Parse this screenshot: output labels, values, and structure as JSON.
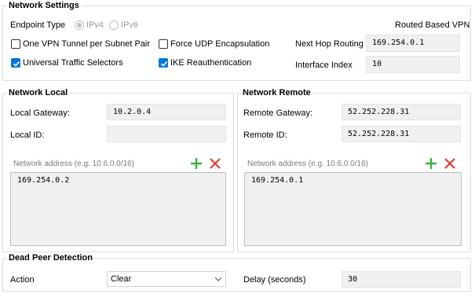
{
  "network_settings": {
    "title": "Network Settings",
    "endpoint_type_label": "Endpoint Type",
    "ipv4_label": "IPv4",
    "ipv6_label": "IPv6",
    "routed_based_vpn_label": "Routed Based VPN",
    "one_vpn_tunnel_label": "One VPN Tunnel per Subnet Pair",
    "force_udp_label": "Force UDP Encapsulation",
    "universal_ts_label": "Universal Traffic Selectors",
    "ike_reauth_label": "IKE Reauthentication",
    "next_hop_label": "Next Hop Routing",
    "next_hop_value": "169.254.0.1",
    "interface_index_label": "Interface Index",
    "interface_index_value": "10",
    "one_vpn_tunnel_checked": false,
    "force_udp_checked": false,
    "universal_ts_checked": true,
    "ike_reauth_checked": true,
    "endpoint_selected": "IPv4"
  },
  "network_local": {
    "title": "Network Local",
    "gateway_label": "Local Gateway:",
    "gateway_value": "10.2.0.4",
    "id_label": "Local ID:",
    "id_value": "",
    "address_placeholder": "Network address (e.g. 10.6.0.0/16)",
    "addresses": [
      "169.254.0.2"
    ]
  },
  "network_remote": {
    "title": "Network Remote",
    "gateway_label": "Remote Gateway:",
    "gateway_value": "52.252.228.31",
    "id_label": "Remote ID:",
    "id_value": "52.252.228.31",
    "address_placeholder": "Network address (e.g. 10.6.0.0/16)",
    "addresses": [
      "169.254.0.1"
    ]
  },
  "dead_peer": {
    "title": "Dead Peer Detection",
    "action_label": "Action",
    "action_value": "Clear",
    "delay_label": "Delay (seconds)",
    "delay_value": "30"
  },
  "colors": {
    "accent": "#0078d7",
    "add_green": "#3cb043",
    "remove_red": "#e03c3c"
  }
}
